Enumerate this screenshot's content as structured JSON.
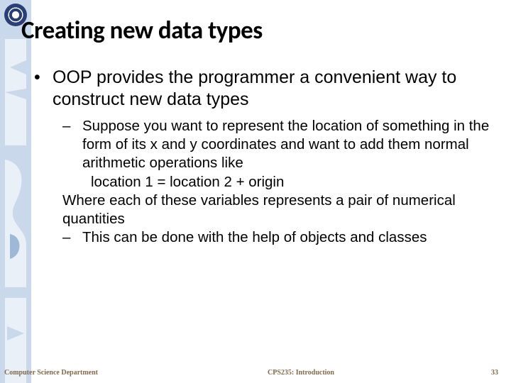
{
  "title": "Creating new data types",
  "main_point": "OOP provides the programmer a convenient way to construct new data types",
  "sub": {
    "s1": "Suppose you want to represent the location of something in the form of its x and y coordinates and want to add them normal arithmetic operations like",
    "code": "location 1 = location 2 + origin",
    "where": "Where each of these variables represents a pair of numerical quantities",
    "s2": "This can be done with the help of objects and classes"
  },
  "footer": {
    "left": "Computer Science Department",
    "center": "CPS235: Introduction",
    "right": "33"
  },
  "glyphs": {
    "bullet": "•",
    "dash": "–"
  }
}
